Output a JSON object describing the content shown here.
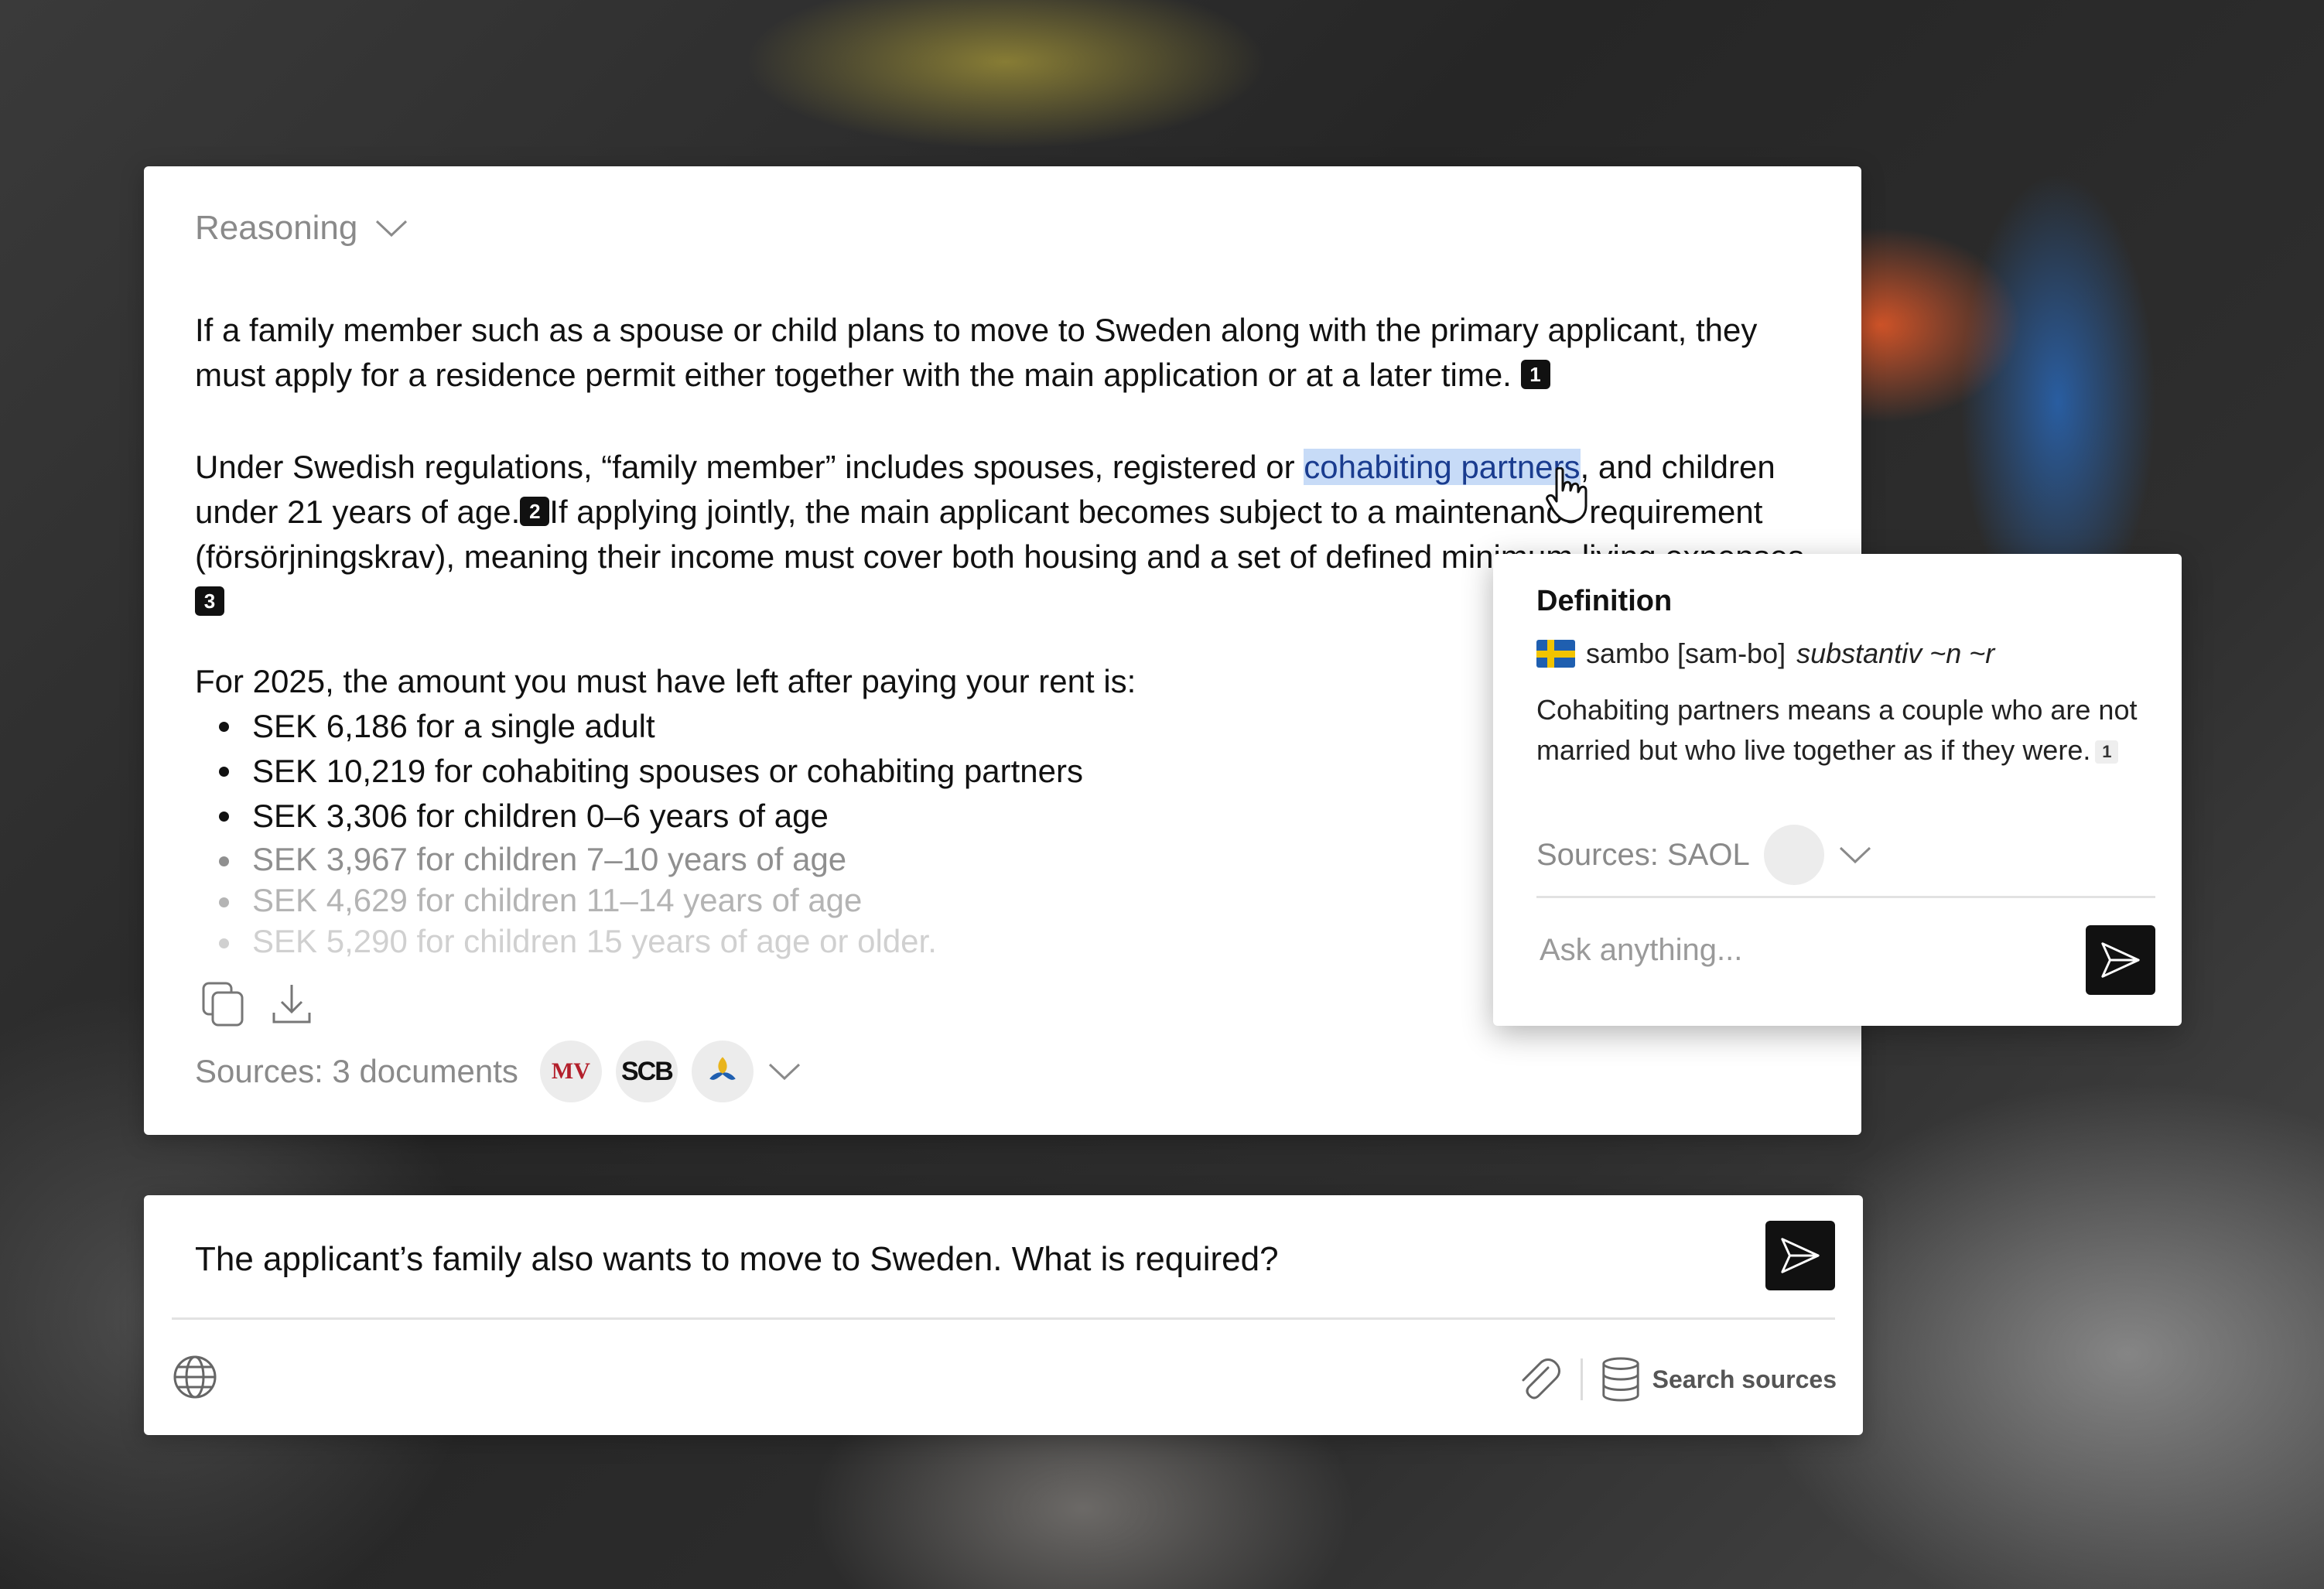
{
  "answer": {
    "reasoning_label": "Reasoning",
    "para1": "If a family member such as a spouse or child plans to move to Sweden along with the primary applicant, they must apply for a residence permit either together with the main application or at a later time.",
    "para2_a": "Under Swedish regulations, “family member” includes spouses, registered or ",
    "para2_highlight": "cohabiting partners",
    "para2_b": ", and children under 21 years of age.",
    "para2_c": "If applying jointly, the main applicant becomes subject to a maintenance requirement (försörjningskrav), meaning their income must cover both housing and a set of defined minimum living expenses.",
    "citations": [
      "1",
      "2",
      "3"
    ],
    "list_intro": "For 2025, the amount you must have left after paying your rent is:",
    "list_items": [
      "SEK 6,186 for a single adult",
      "SEK 10,219 for cohabiting spouses or cohabiting partners",
      "SEK 3,306 for children 0–6 years of age",
      "SEK 3,967 for children 7–10 years of age",
      "SEK 4,629 for children 11–14 years of age",
      "SEK 5,290 for children 15 years of age or older."
    ],
    "sources_label": "Sources: 3 documents",
    "source_logos": [
      "MV",
      "SCB",
      "Skatteverket"
    ]
  },
  "prompt": {
    "text": "The applicant’s family also wants to move to Sweden. What is required?",
    "search_sources_label": "Search sources"
  },
  "definition": {
    "title": "Definition",
    "word": "sambo [sam-bo]",
    "grammar": "substantiv ~n ~r",
    "body": "Cohabiting partners means a couple who are not married but who live together as if they were.",
    "citation": "1",
    "sources_label": "Sources: SAOL",
    "ask_placeholder": "Ask anything..."
  },
  "icons": [
    "chevron-down-icon",
    "copy-icon",
    "download-icon",
    "send-icon",
    "globe-icon",
    "paperclip-icon",
    "database-icon",
    "sweden-flag-icon",
    "pointer-cursor-icon"
  ],
  "colors": {
    "highlight": "#c7dbf7",
    "button": "#111111",
    "muted": "#8a8a8a"
  }
}
